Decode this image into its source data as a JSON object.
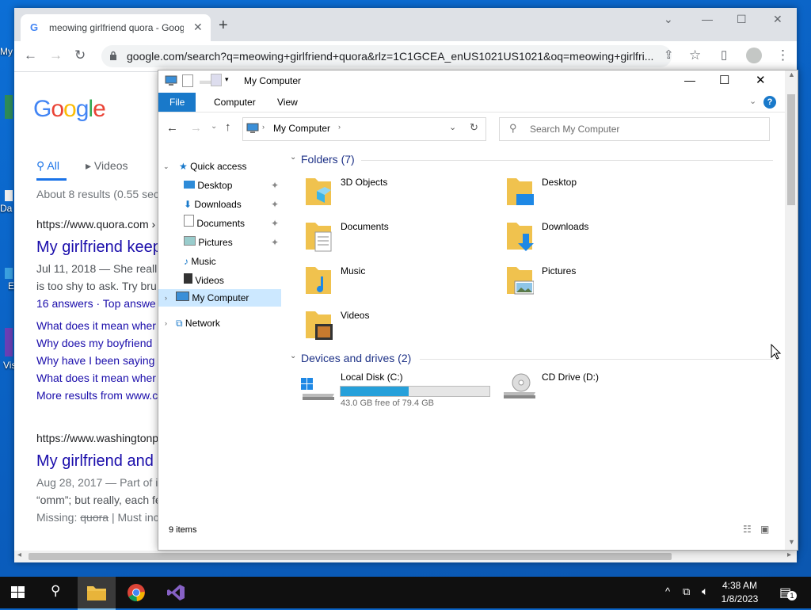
{
  "desktop": {
    "icons": [
      {
        "label": "My"
      },
      {
        "label": "Da"
      },
      {
        "label": "E"
      },
      {
        "label": "Vis"
      }
    ]
  },
  "chrome": {
    "tab_title": "meowing girlfriend quora - Goog",
    "url": "google.com/search?q=meowing+girlfriend+quora&rlz=1C1GCEA_enUS1021US1021&oq=meowing+girlfri..."
  },
  "google": {
    "logo_letters": [
      "G",
      "o",
      "o",
      "g",
      "l",
      "e"
    ],
    "tabs": [
      {
        "label": "All"
      },
      {
        "label": "Videos"
      }
    ],
    "result_count": "About 8 results (0.55 sec",
    "result1": {
      "site": "https://www.quora.com ›",
      "title": "My girlfriend keep",
      "snippet1": "Jul 11, 2018 — She reall",
      "snippet2": "is too shy to ask. Try bru",
      "answers": "16 answers · Top answe"
    },
    "related": [
      "What does it mean wher",
      "Why does my boyfriend",
      "Why have I been saying",
      "What does it mean wher",
      "More results from www.c"
    ],
    "result2": {
      "site": "https://www.washingtonp",
      "title": "My girlfriend and",
      "snippet1": "Aug 28, 2017 — Part of i",
      "snippet2": "“omm”; but really, each fe",
      "missing_label": "Missing:",
      "missing_word": "quora",
      "missing_rest": "| Must inc"
    }
  },
  "explorer": {
    "title": "My Computer",
    "ribbon_tabs": [
      "File",
      "Computer",
      "View"
    ],
    "address": "My Computer",
    "search_placeholder": "Search My Computer",
    "nav": {
      "quick_access": "Quick access",
      "items": [
        "Desktop",
        "Downloads",
        "Documents",
        "Pictures",
        "Music",
        "Videos"
      ],
      "my_computer": "My Computer",
      "network": "Network"
    },
    "folders_header": "Folders (7)",
    "folders": [
      "3D Objects",
      "Desktop",
      "Documents",
      "Downloads",
      "Music",
      "Pictures",
      "Videos"
    ],
    "drives_header": "Devices and drives (2)",
    "drives": [
      {
        "name": "Local Disk (C:)",
        "free": "43.0 GB free of 79.4 GB",
        "used_fraction": 0.46
      },
      {
        "name": "CD Drive (D:)"
      }
    ],
    "status": "9 items"
  },
  "taskbar": {
    "time": "4:38 AM",
    "date": "1/8/2023",
    "notification_count": "1"
  }
}
